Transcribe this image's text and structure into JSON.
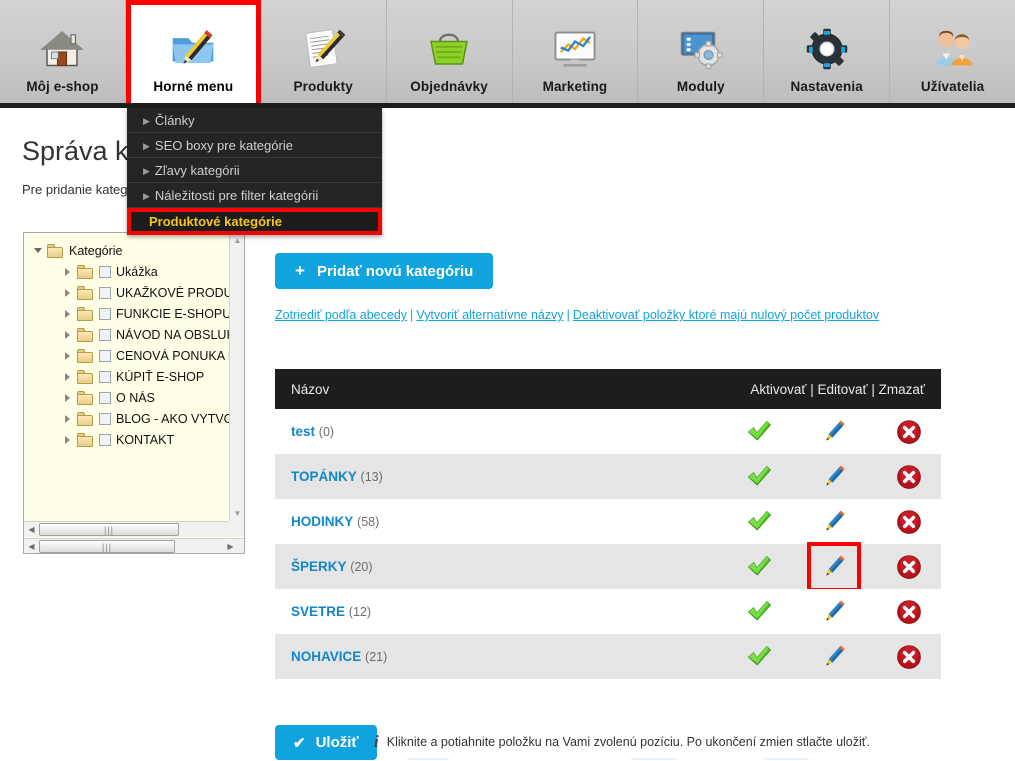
{
  "nav": {
    "items": [
      {
        "label": "Môj e-shop",
        "icon": "house-icon",
        "active": false
      },
      {
        "label": "Horné menu",
        "icon": "folder-pencil-icon",
        "active": true
      },
      {
        "label": "Produkty",
        "icon": "document-pencil-icon",
        "active": false
      },
      {
        "label": "Objednávky",
        "icon": "shopping-basket-icon",
        "active": false
      },
      {
        "label": "Marketing",
        "icon": "monitor-chart-icon",
        "active": false
      },
      {
        "label": "Moduly",
        "icon": "screen-gear-icon",
        "active": false
      },
      {
        "label": "Nastavenia",
        "icon": "gears-icon",
        "active": false
      },
      {
        "label": "Užívatelia",
        "icon": "users-icon",
        "active": false
      }
    ]
  },
  "dropdown": {
    "items": [
      {
        "label": "Články",
        "highlight": false
      },
      {
        "label": "SEO boxy pre kategórie",
        "highlight": false
      },
      {
        "label": "Zľavy kategórii",
        "highlight": false
      },
      {
        "label": "Náležitosti pre filter kategórii",
        "highlight": false
      },
      {
        "label": "Produktové kategórie",
        "highlight": true
      }
    ]
  },
  "page": {
    "title": "Správa kategórií",
    "description": "Pre pridanie kategórie zvoľte úroveň kategórií."
  },
  "tree": {
    "root": {
      "label": "Kategórie",
      "icon": "folder-icon"
    },
    "children": [
      {
        "label": "Ukážka"
      },
      {
        "label": "UKAŽKOVÉ PRODUKTY"
      },
      {
        "label": "FUNKCIE E-SHOPU"
      },
      {
        "label": "NÁVOD NA OBSLUHU"
      },
      {
        "label": "CENOVÁ PONUKA NA W"
      },
      {
        "label": "KÚPIŤ E-SHOP"
      },
      {
        "label": "O NÁS"
      },
      {
        "label": "BLOG - AKO VYTVORIŤ"
      },
      {
        "label": "KONTAKT"
      }
    ]
  },
  "toolbar": {
    "add_label": "Pridať novú kategóriu",
    "add_plus": "+",
    "links": [
      "Zotriediť podľa abecedy",
      "Vytvoriť alternatívne názvy",
      "Deaktivovať položky ktoré majú nulový počet produktov"
    ],
    "link_separator": "|"
  },
  "table": {
    "header": {
      "name": "Názov",
      "activate": "Aktivovať",
      "edit": "Editovať",
      "delete": "Zmazať",
      "sep": "|"
    },
    "rows": [
      {
        "name": "test",
        "count": "(0)",
        "highlight_edit": false
      },
      {
        "name": "TOPÁNKY",
        "count": "(13)",
        "highlight_edit": false
      },
      {
        "name": "HODINKY",
        "count": "(58)",
        "highlight_edit": false
      },
      {
        "name": "ŠPERKY",
        "count": "(20)",
        "highlight_edit": true
      },
      {
        "name": "SVETRE",
        "count": "(12)",
        "highlight_edit": false
      },
      {
        "name": "NOHAVICE",
        "count": "(21)",
        "highlight_edit": false
      }
    ]
  },
  "footer": {
    "save_label": "Uložiť",
    "save_check": "✔",
    "info_glyph": "i",
    "hint": "Kliknite a potiahnite položku na Vami zvolenú pozíciu. Po ukončení zmien stlačte uložiť."
  },
  "colors": {
    "accent": "#11a3dd",
    "highlight_border": "#fb0000",
    "menu_highlight_text": "#f5c518",
    "header_bar": "#1d1d1d",
    "tree_bg": "#ffffe8",
    "row_alt": "#e5e5e5"
  }
}
